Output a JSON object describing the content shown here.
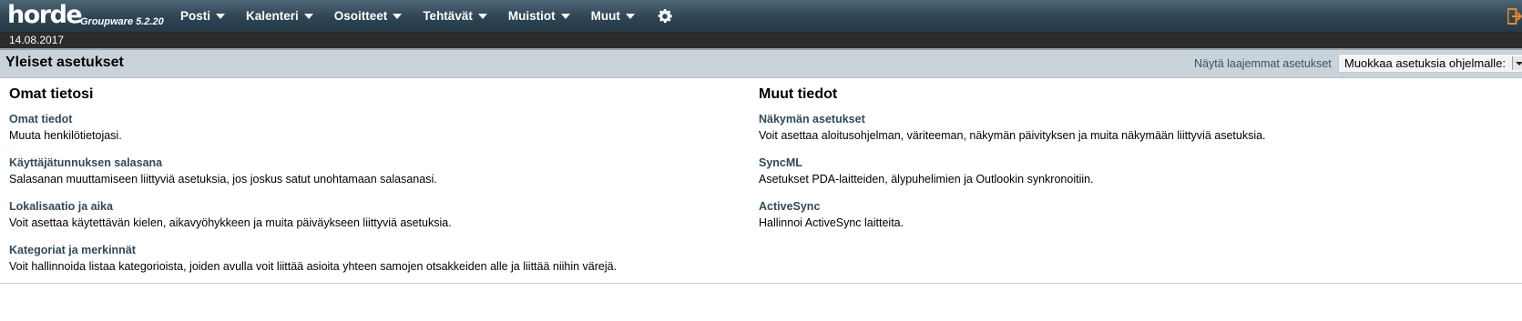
{
  "app": {
    "logo": "horde",
    "version": "Groupware 5.2.20"
  },
  "menu": [
    {
      "label": "Posti"
    },
    {
      "label": "Kalenteri"
    },
    {
      "label": "Osoitteet"
    },
    {
      "label": "Tehtävät"
    },
    {
      "label": "Muistiot"
    },
    {
      "label": "Muut"
    }
  ],
  "date": "14.08.2017",
  "header": {
    "title": "Yleiset asetukset",
    "advanced_link": "Näytä laajemmat asetukset",
    "app_select_value": "Muokkaa asetuksia ohjelmalle:"
  },
  "left": {
    "heading": "Omat tietosi",
    "items": [
      {
        "title": "Omat tiedot",
        "desc": "Muuta henkilötietojasi."
      },
      {
        "title": "Käyttäjätunnuksen salasana",
        "desc": "Salasanan muuttamiseen liittyviä asetuksia, jos joskus satut unohtamaan salasanasi."
      },
      {
        "title": "Lokalisaatio ja aika",
        "desc": "Voit asettaa käytettävän kielen, aikavyöhykkeen ja muita päiväykseen liittyviä asetuksia."
      },
      {
        "title": "Kategoriat ja merkinnät",
        "desc": "Voit hallinnoida listaa kategorioista, joiden avulla voit liittää asioita yhteen samojen otsakkeiden alle ja liittää niihin värejä."
      }
    ]
  },
  "right": {
    "heading": "Muut tiedot",
    "items": [
      {
        "title": "Näkymän asetukset",
        "desc": "Voit asettaa aloitusohjelman, väriteeman, näkymän päivityksen ja muita näkymään liittyviä asetuksia."
      },
      {
        "title": "SyncML",
        "desc": "Asetukset PDA-laitteiden, älypuhelimien ja Outlookin synkronoitiin."
      },
      {
        "title": "ActiveSync",
        "desc": "Hallinnoi ActiveSync laitteita."
      }
    ]
  },
  "icons": {
    "settings": "gear-icon",
    "logout": "logout-icon",
    "menu_caret": "chevron-down-icon"
  },
  "colors": {
    "topbar": "#2e4453",
    "datebar": "#2c2c2c",
    "header_bg": "#c9d3d9",
    "link": "#2f4a5c",
    "logout_accent": "#e8872a"
  }
}
